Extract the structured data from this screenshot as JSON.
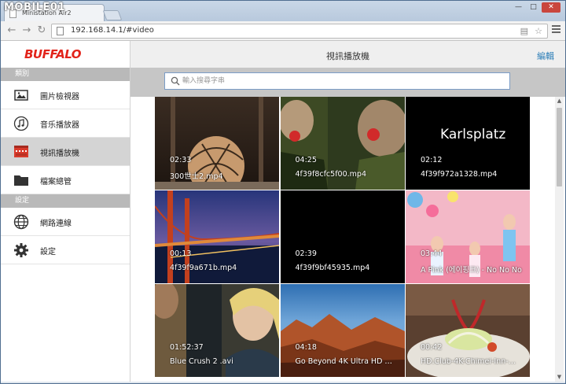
{
  "browser": {
    "tab_title": "Ministation Air2",
    "url": "192.168.14.1/#video",
    "watermark": "MOBILE01"
  },
  "sidebar": {
    "logo": "BUFFALO",
    "sections": [
      {
        "title": "類別",
        "items": [
          {
            "label": "圖片檢視器",
            "icon": "image-icon"
          },
          {
            "label": "音乐播放器",
            "icon": "music-icon"
          },
          {
            "label": "視訊播放機",
            "icon": "video-icon"
          },
          {
            "label": "檔案總管",
            "icon": "folder-icon"
          }
        ]
      },
      {
        "title": "設定",
        "items": [
          {
            "label": "網路連線",
            "icon": "globe-icon"
          },
          {
            "label": "設定",
            "icon": "gear-icon"
          }
        ]
      }
    ]
  },
  "main": {
    "title": "視訊播放機",
    "edit_label": "編輯",
    "search_placeholder": "輸入搜尋字串",
    "caption_karlsplatz": "Karlsplatz",
    "videos": [
      {
        "duration": "02:33",
        "name": "300世士2.mp4"
      },
      {
        "duration": "04:25",
        "name": "4f39f8cfc5f00.mp4"
      },
      {
        "duration": "02:12",
        "name": "4f39f972a1328.mp4"
      },
      {
        "duration": "00:13",
        "name": "4f39f9a671b.mp4"
      },
      {
        "duration": "02:39",
        "name": "4f39f9bf45935.mp4"
      },
      {
        "duration": "03:44",
        "name": "A Pink (에이핑크) - No No No"
      },
      {
        "duration": "01:52:37",
        "name": "Blue Crush 2 .avi"
      },
      {
        "duration": "04:18",
        "name": "Go Beyond 4K Ultra HD …"
      },
      {
        "duration": "00:42",
        "name": "HD.Club-4K-Chimei-Inn-…"
      }
    ]
  }
}
